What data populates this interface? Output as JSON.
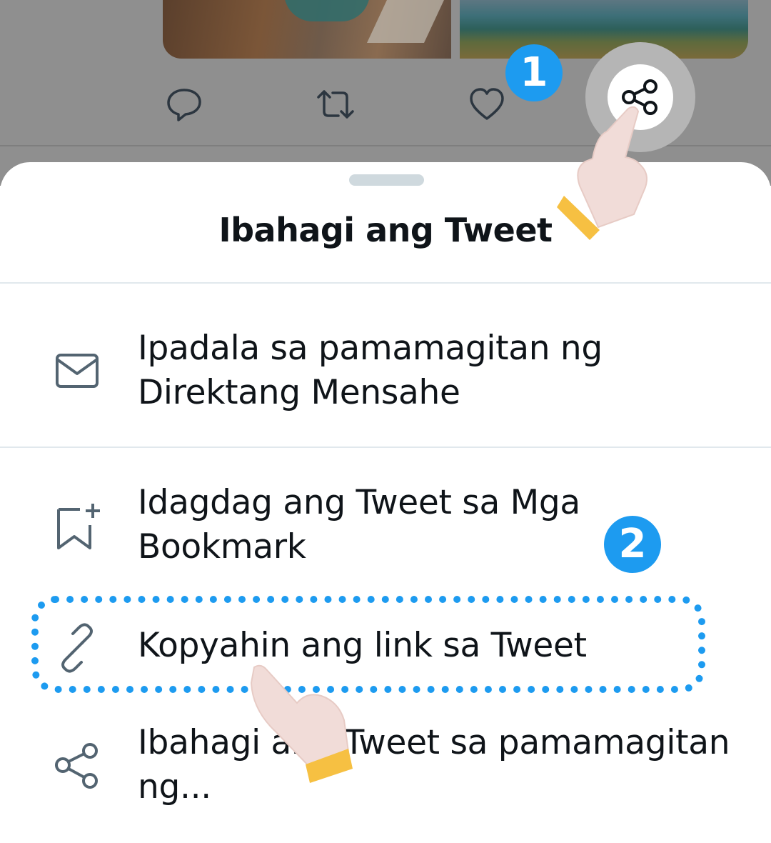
{
  "timeline": {
    "actions": [
      {
        "name": "reply",
        "icon": "reply-icon"
      },
      {
        "name": "retweet",
        "icon": "retweet-icon"
      },
      {
        "name": "like",
        "icon": "heart-icon"
      },
      {
        "name": "share",
        "icon": "share-icon"
      }
    ]
  },
  "annotations": {
    "step1": "1",
    "step2": "2"
  },
  "share_sheet": {
    "title": "Ibahagi ang Tweet",
    "items": [
      {
        "icon": "envelope-icon",
        "label": "Ipadala sa pamamagitan ng Direktang Mensahe"
      },
      {
        "icon": "bookmark-add-icon",
        "label": "Idagdag ang Tweet sa Mga Bookmark"
      },
      {
        "icon": "link-icon",
        "label": "Kopyahin ang link sa Tweet"
      },
      {
        "icon": "share-icon",
        "label": "Ibahagi ang Tweet sa pamamagitan ng..."
      }
    ]
  },
  "colors": {
    "accent": "#1d9bf0",
    "text": "#0f1419",
    "icon": "#536471",
    "backdrop": "#8f8f8f"
  }
}
